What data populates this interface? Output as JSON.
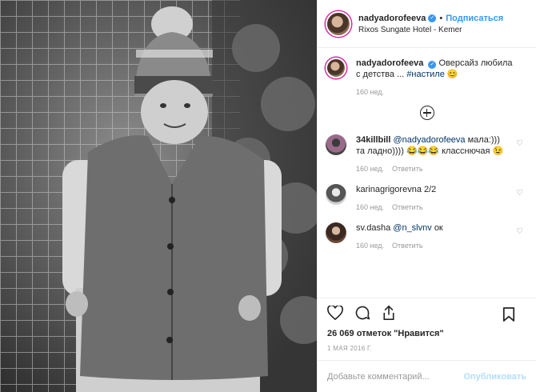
{
  "post": {
    "username": "nadyadorofeeva",
    "follow_label": "Подписаться",
    "separator": "•",
    "location": "Rixos Sungate Hotel - Kemer"
  },
  "caption": {
    "username": "nadyadorofeeva",
    "text": "Оверсайз любила с детства ...",
    "hashtag": "#настиле",
    "emoji": "😊",
    "time": "160 нед."
  },
  "comments": [
    {
      "username": "34killbill",
      "mention": "@nadyadorofeeva",
      "text": "мала:))) та ладно)))) 😂😂😂 класснючая 😉",
      "time": "160 нед.",
      "reply_label": "Ответить"
    },
    {
      "username": "karinagrigorevna",
      "mention": "",
      "text": "2/2",
      "time": "160 нед.",
      "reply_label": "Ответить"
    },
    {
      "username": "sv.dasha",
      "mention": "@n_slvnv",
      "text": "ок",
      "time": "160 нед.",
      "reply_label": "Ответить"
    }
  ],
  "stats": {
    "likes": "26 069 отметок \"Нравится\"",
    "date": "1 МАЯ 2016 Г."
  },
  "add_comment": {
    "placeholder": "Добавьте комментарий...",
    "publish_label": "Опубликовать"
  },
  "icons": [
    "heart-icon",
    "comment-icon",
    "share-icon",
    "bookmark-icon",
    "verified-icon",
    "load-more-icon"
  ],
  "colors": {
    "accent": "#3897f0",
    "text": "#262626",
    "muted": "#999999",
    "border": "#efefef"
  }
}
